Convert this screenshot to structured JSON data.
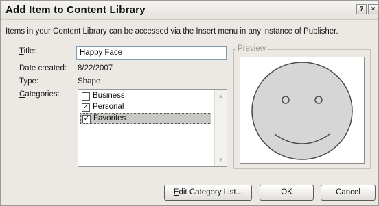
{
  "window": {
    "title": "Add Item to Content Library"
  },
  "titlebar": {
    "help": "?",
    "close": "×"
  },
  "intro": "Items in your Content Library can be accessed via the Insert menu in any instance of Publisher.",
  "fields": {
    "title_label_mnemonic": "T",
    "title_label_rest": "itle:",
    "title_value": "Happy Face",
    "date_label": "Date created:",
    "date_value": "8/22/2007",
    "type_label": "Type:",
    "type_value": "Shape",
    "categories_label_mnemonic": "C",
    "categories_label_rest": "ategories:"
  },
  "categories": [
    {
      "label": "Business",
      "checked": false,
      "selected": false
    },
    {
      "label": "Personal",
      "checked": true,
      "selected": false
    },
    {
      "label": "Favorites",
      "checked": true,
      "selected": true
    }
  ],
  "preview": {
    "label": "Preview",
    "face_fill": "#d6d6d6"
  },
  "buttons": {
    "edit_mnemonic": "E",
    "edit_rest": "dit Category List...",
    "ok": "OK",
    "cancel": "Cancel"
  }
}
